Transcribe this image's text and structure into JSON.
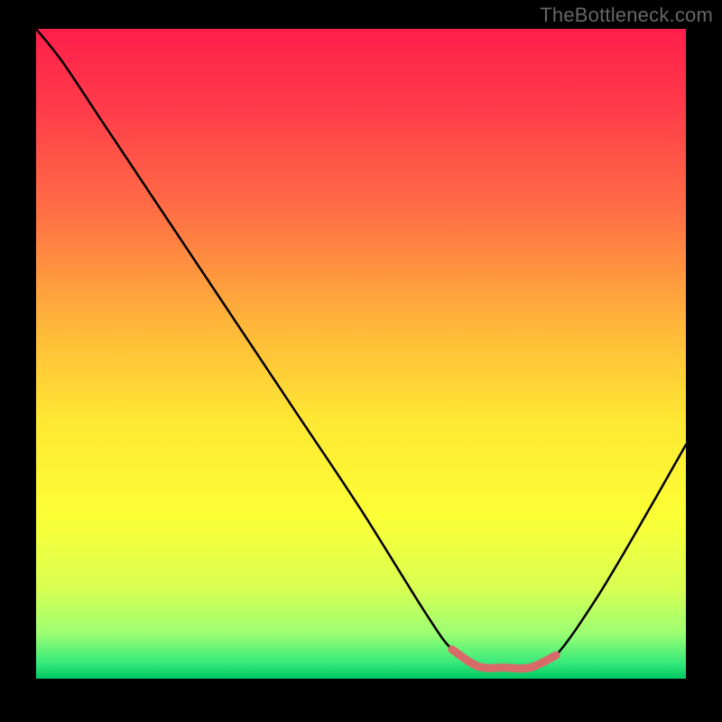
{
  "watermark": "TheBottleneck.com",
  "chart_data": {
    "type": "line",
    "title": "",
    "xlabel": "",
    "ylabel": "",
    "xlim": [
      0,
      100
    ],
    "ylim": [
      0,
      100
    ],
    "grid": false,
    "series": [
      {
        "name": "bottleneck-curve",
        "x": [
          0,
          4,
          10,
          20,
          30,
          40,
          50,
          60,
          64,
          68,
          72,
          76,
          80,
          86,
          92,
          100
        ],
        "y": [
          100,
          95,
          86,
          71,
          56,
          41,
          26,
          10,
          4.5,
          1.9,
          1.7,
          1.7,
          3.6,
          12,
          22,
          36
        ],
        "color": "#000000"
      },
      {
        "name": "optimal-band",
        "x": [
          64,
          68,
          72,
          76,
          80
        ],
        "y": [
          4.5,
          1.9,
          1.7,
          1.7,
          3.6
        ],
        "color": "#d96a6a"
      }
    ],
    "gradient_stops": [
      {
        "offset": 0.0,
        "color": "#ff1f4b"
      },
      {
        "offset": 0.12,
        "color": "#ff3b4a"
      },
      {
        "offset": 0.28,
        "color": "#ff6e45"
      },
      {
        "offset": 0.45,
        "color": "#ffb43a"
      },
      {
        "offset": 0.6,
        "color": "#ffe733"
      },
      {
        "offset": 0.75,
        "color": "#fbff34"
      },
      {
        "offset": 0.86,
        "color": "#d9ff52"
      },
      {
        "offset": 0.93,
        "color": "#9cff72"
      },
      {
        "offset": 0.975,
        "color": "#38ea7b"
      },
      {
        "offset": 1.0,
        "color": "#00c862"
      }
    ]
  }
}
